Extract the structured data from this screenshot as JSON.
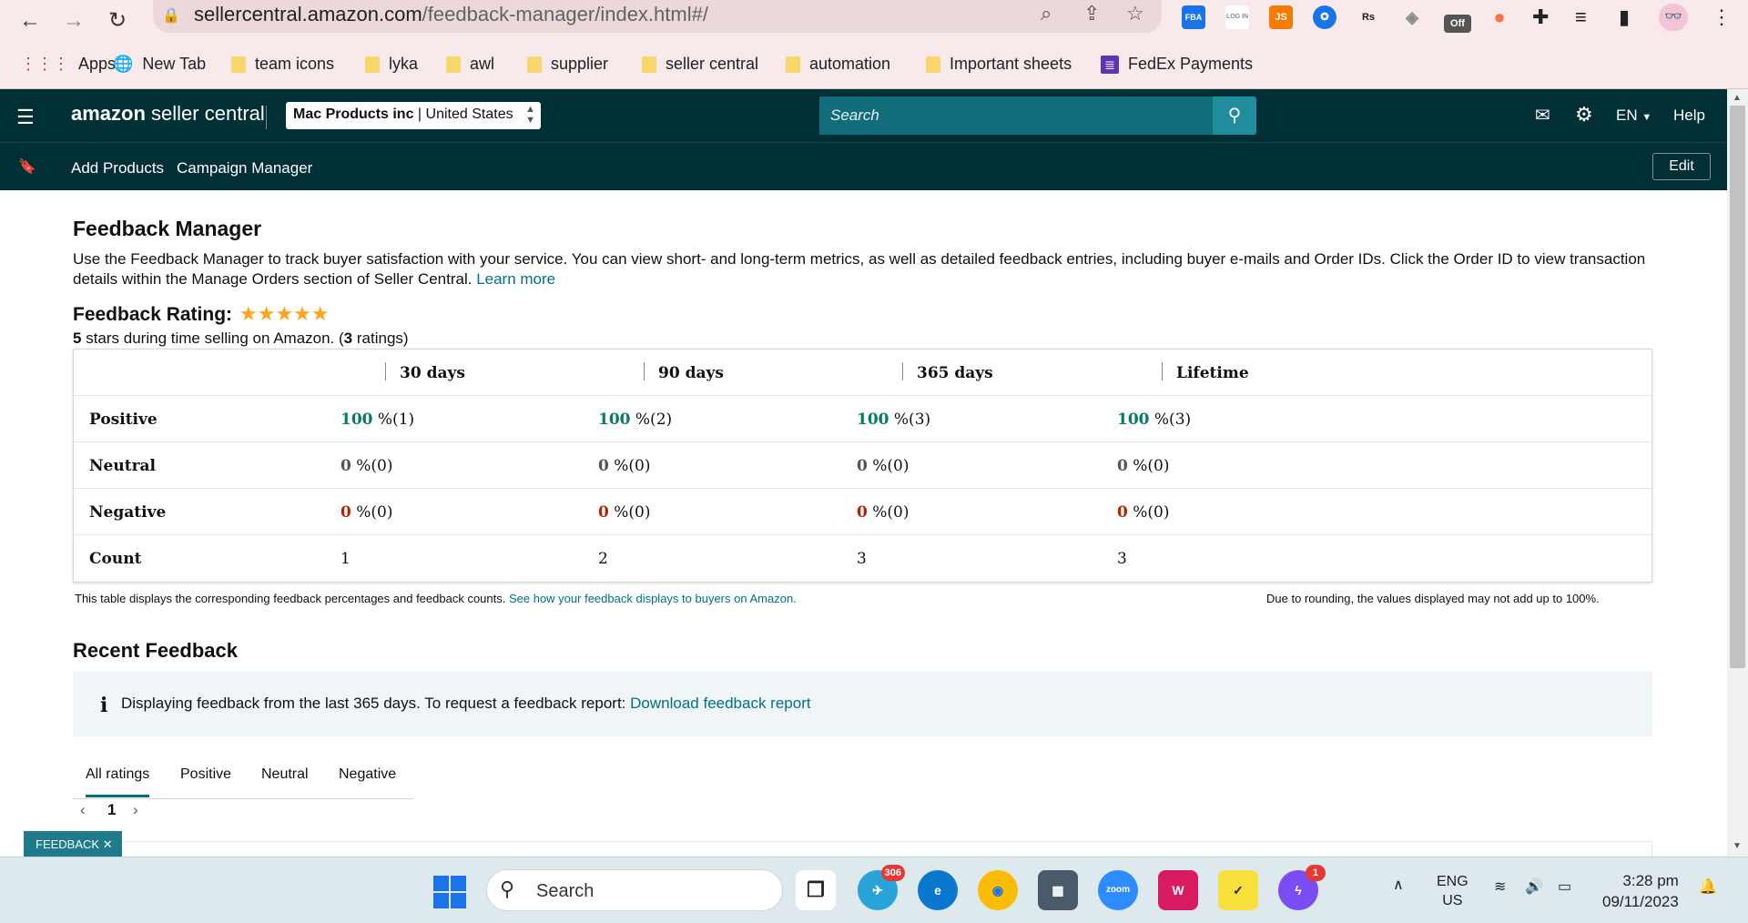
{
  "browser": {
    "url_host": "sellercentral.amazon.com",
    "url_path": "/feedback-manager/index.html#/",
    "extensions": [
      {
        "name": "fba-extension",
        "label": "FBA",
        "color": "#1a73e8"
      },
      {
        "name": "login-extension",
        "label": "LOG IN",
        "color": "#888888"
      },
      {
        "name": "js-extension",
        "label": "JS",
        "color": "#f57c00"
      },
      {
        "name": "gear-extension",
        "label": "✪",
        "color": "#1a73e8"
      },
      {
        "name": "rs-extension",
        "label": "Rs",
        "color": "#ffffff"
      },
      {
        "name": "box-extension",
        "label": "◈",
        "color": "#888888"
      },
      {
        "name": "off-extension",
        "label": "Off",
        "color": "#555555"
      },
      {
        "name": "color-extension",
        "label": "●",
        "color": "#ff7043"
      }
    ],
    "bookmarks": [
      "Apps",
      "New Tab",
      "team icons",
      "lyka",
      "awl",
      "supplier",
      "seller central",
      "automation",
      "Important sheets",
      "FedEx Payments"
    ]
  },
  "header": {
    "logo_brand": "amazon",
    "logo_product": "seller central",
    "account_name": "Mac Products inc",
    "account_region": "United States",
    "search_placeholder": "Search",
    "language": "EN",
    "help": "Help",
    "subnav_links": [
      "Add Products",
      "Campaign Manager"
    ],
    "edit": "Edit"
  },
  "page": {
    "title": "Feedback Manager",
    "description": "Use the Feedback Manager to track buyer satisfaction with your service. You can view short- and long-term metrics, as well as detailed feedback entries, including buyer e-mails and Order IDs. Click the Order ID to view transaction details within the Manage Orders section of Seller Central.",
    "learn_more": "Learn more",
    "rating_title": "Feedback Rating:",
    "stars": "★★★★★",
    "rating_stars_value": "5",
    "rating_sub_middle": "stars during time selling on Amazon. (",
    "rating_count": "3",
    "rating_sub_end": "ratings)"
  },
  "table": {
    "columns": [
      "30 days",
      "90 days",
      "365 days",
      "Lifetime"
    ],
    "rows": [
      {
        "label": "Positive",
        "values": [
          {
            "pct": "100",
            "rest": " %(1)"
          },
          {
            "pct": "100",
            "rest": " %(2)"
          },
          {
            "pct": "100",
            "rest": " %(3)"
          },
          {
            "pct": "100",
            "rest": " %(3)"
          }
        ]
      },
      {
        "label": "Neutral",
        "values": [
          {
            "pct": "0",
            "rest": " %(0)"
          },
          {
            "pct": "0",
            "rest": " %(0)"
          },
          {
            "pct": "0",
            "rest": " %(0)"
          },
          {
            "pct": "0",
            "rest": " %(0)"
          }
        ]
      },
      {
        "label": "Negative",
        "values": [
          {
            "pct": "0",
            "rest": " %(0)"
          },
          {
            "pct": "0",
            "rest": " %(0)"
          },
          {
            "pct": "0",
            "rest": " %(0)"
          },
          {
            "pct": "0",
            "rest": " %(0)"
          }
        ]
      },
      {
        "label": "Count",
        "values": [
          "1",
          "2",
          "3",
          "3"
        ]
      }
    ],
    "note_left": "This table displays the corresponding feedback percentages and feedback counts.",
    "note_link": "See how your feedback displays to buyers on Amazon.",
    "note_right": "Due to rounding, the values displayed may not add up to 100%."
  },
  "recent": {
    "title": "Recent Feedback",
    "alert_text": "Displaying feedback from the last 365 days. To request a feedback report:",
    "alert_link": "Download feedback report",
    "tabs": [
      "All ratings",
      "Positive",
      "Neutral",
      "Negative"
    ],
    "page": "1",
    "feedback_tag": "FEEDBACK"
  },
  "taskbar": {
    "search": "Search",
    "telegram_badge": "306",
    "messenger_badge": "1",
    "zoom_label": "zoom",
    "lang_top": "ENG",
    "lang_bottom": "US",
    "time": "3:28 pm",
    "date": "09/11/2023"
  },
  "colors": {
    "header_bg": "#002f36",
    "link": "#007185",
    "positive": "#067d62",
    "negative": "#b12704",
    "star": "#ffa41c"
  }
}
